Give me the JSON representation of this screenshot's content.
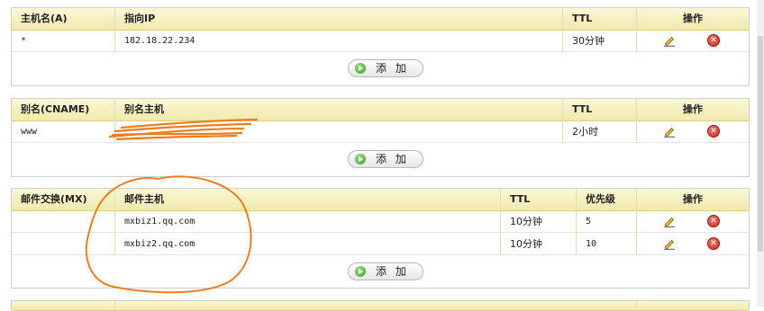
{
  "a_records": {
    "headers": [
      "主机名(A)",
      "指向IP",
      "TTL",
      "操作"
    ],
    "rows": [
      {
        "host": "*",
        "ip": "182.18.22.234",
        "ttl": "30分钟"
      }
    ],
    "add_label": "添 加"
  },
  "cname_records": {
    "headers": [
      "别名(CNAME)",
      "别名主机",
      "TTL",
      "操作"
    ],
    "rows": [
      {
        "alias": "www",
        "target": "",
        "ttl": "2小时"
      }
    ],
    "add_label": "添 加"
  },
  "mx_records": {
    "headers": [
      "邮件交换(MX)",
      "邮件主机",
      "TTL",
      "优先级",
      "操作"
    ],
    "rows": [
      {
        "exchange": "",
        "host": "mxbiz1.qq.com",
        "ttl": "10分钟",
        "priority": "5"
      },
      {
        "exchange": "",
        "host": "mxbiz2.qq.com",
        "ttl": "10分钟",
        "priority": "10"
      }
    ],
    "add_label": "添 加"
  },
  "icons": {
    "edit": "pencil-icon",
    "delete": "delete-x-icon",
    "add": "play-circle-icon"
  },
  "colors": {
    "header_bg": "#f1e9ad",
    "delete_red": "#c8271a",
    "annotation_orange": "#f07d1c"
  }
}
